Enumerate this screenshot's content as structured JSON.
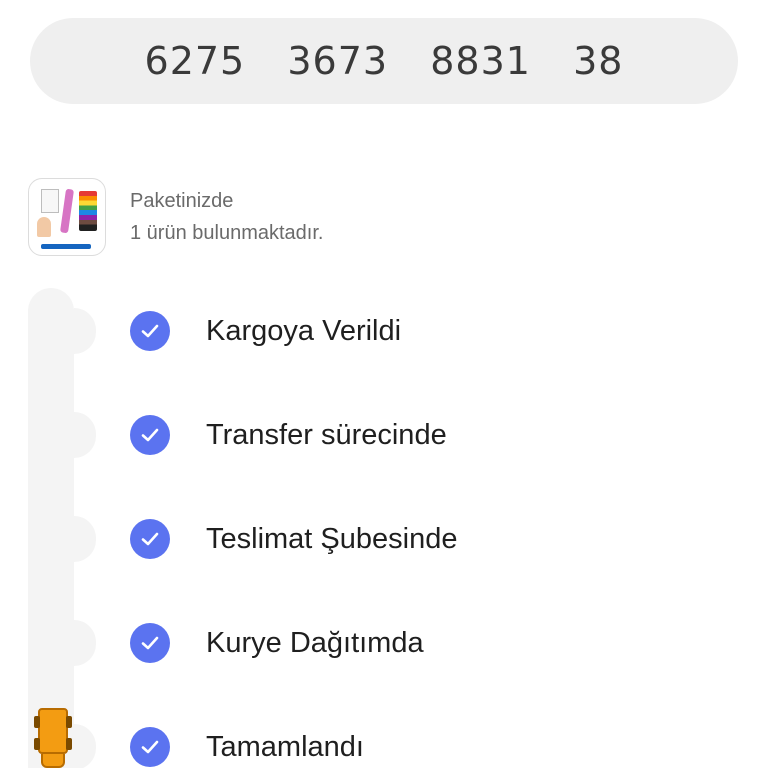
{
  "tracking": {
    "number": "6275  3673  8831  38"
  },
  "package": {
    "line1": "Paketinizde",
    "line2": "1 ürün bulunmaktadır."
  },
  "steps": [
    {
      "label": "Kargoya Verildi",
      "completed": true
    },
    {
      "label": "Transfer sürecinde",
      "completed": true
    },
    {
      "label": "Teslimat Şubesinde",
      "completed": true
    },
    {
      "label": "Kurye Dağıtımda",
      "completed": true
    },
    {
      "label": "Tamamlandı",
      "completed": true
    }
  ],
  "icons": {
    "check": "check-circle-icon",
    "truck": "delivery-truck-icon"
  },
  "colors": {
    "accent": "#5b73f0",
    "truck": "#f39c12",
    "pill_bg": "#efefef"
  }
}
